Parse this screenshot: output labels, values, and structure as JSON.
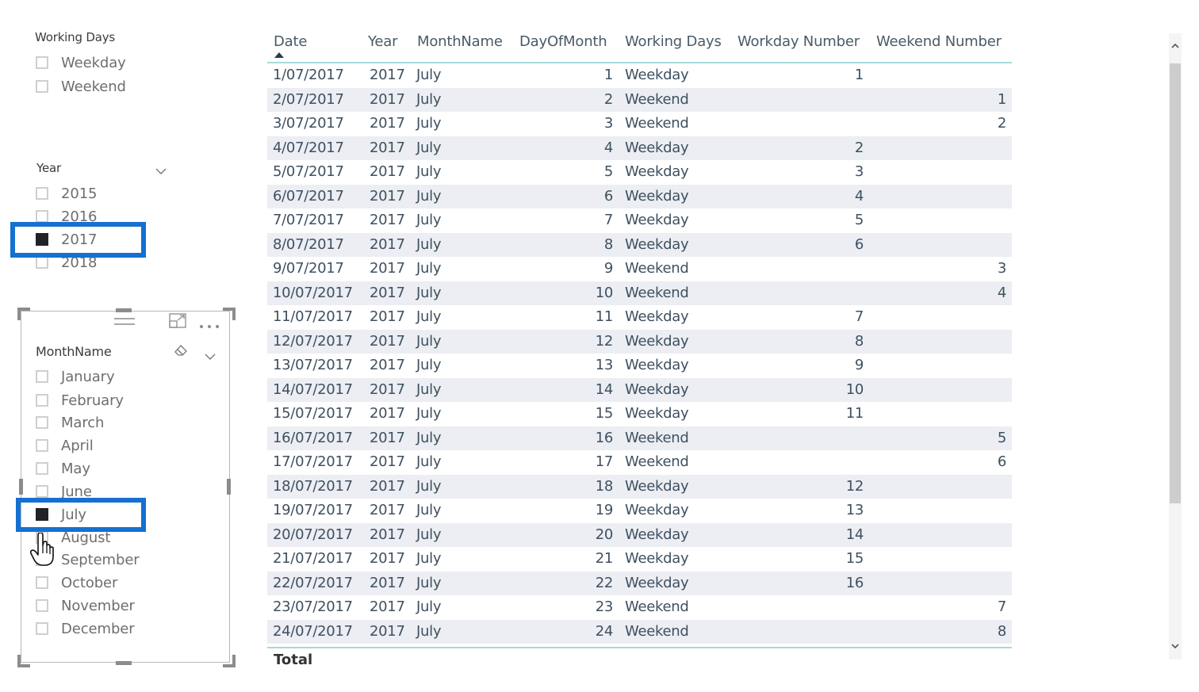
{
  "working_days_slicer": {
    "title": "Working Days",
    "items": [
      {
        "label": "Weekday",
        "checked": false
      },
      {
        "label": "Weekend",
        "checked": false
      }
    ]
  },
  "year_slicer": {
    "title": "Year",
    "dropdown_icon": "chevron-down-icon",
    "items": [
      {
        "label": "2015",
        "checked": false
      },
      {
        "label": "2016",
        "checked": false
      },
      {
        "label": "2017",
        "checked": true
      },
      {
        "label": "2018",
        "checked": false
      }
    ]
  },
  "month_slicer": {
    "title": "MonthName",
    "header_icons": [
      "drag-handle-icon",
      "focus-mode-icon",
      "more-options-icon"
    ],
    "title_icons": [
      "eraser-icon",
      "chevron-down-icon"
    ],
    "items": [
      {
        "label": "January",
        "checked": false
      },
      {
        "label": "February",
        "checked": false
      },
      {
        "label": "March",
        "checked": false
      },
      {
        "label": "April",
        "checked": false
      },
      {
        "label": "May",
        "checked": false
      },
      {
        "label": "June",
        "checked": false
      },
      {
        "label": "July",
        "checked": true
      },
      {
        "label": "August",
        "checked": false
      },
      {
        "label": "September",
        "checked": false
      },
      {
        "label": "October",
        "checked": false
      },
      {
        "label": "November",
        "checked": false
      },
      {
        "label": "December",
        "checked": false
      }
    ]
  },
  "highlight_color": "#1570d1",
  "table": {
    "columns": [
      "Date",
      "Year",
      "MonthName",
      "DayOfMonth",
      "Working Days",
      "Workday Number",
      "Weekend Number"
    ],
    "sorted_column": "Date",
    "sort_direction": "ascending",
    "rows": [
      [
        "1/07/2017",
        "2017",
        "July",
        "1",
        "Weekday",
        "1",
        ""
      ],
      [
        "2/07/2017",
        "2017",
        "July",
        "2",
        "Weekend",
        "",
        "1"
      ],
      [
        "3/07/2017",
        "2017",
        "July",
        "3",
        "Weekend",
        "",
        "2"
      ],
      [
        "4/07/2017",
        "2017",
        "July",
        "4",
        "Weekday",
        "2",
        ""
      ],
      [
        "5/07/2017",
        "2017",
        "July",
        "5",
        "Weekday",
        "3",
        ""
      ],
      [
        "6/07/2017",
        "2017",
        "July",
        "6",
        "Weekday",
        "4",
        ""
      ],
      [
        "7/07/2017",
        "2017",
        "July",
        "7",
        "Weekday",
        "5",
        ""
      ],
      [
        "8/07/2017",
        "2017",
        "July",
        "8",
        "Weekday",
        "6",
        ""
      ],
      [
        "9/07/2017",
        "2017",
        "July",
        "9",
        "Weekend",
        "",
        "3"
      ],
      [
        "10/07/2017",
        "2017",
        "July",
        "10",
        "Weekend",
        "",
        "4"
      ],
      [
        "11/07/2017",
        "2017",
        "July",
        "11",
        "Weekday",
        "7",
        ""
      ],
      [
        "12/07/2017",
        "2017",
        "July",
        "12",
        "Weekday",
        "8",
        ""
      ],
      [
        "13/07/2017",
        "2017",
        "July",
        "13",
        "Weekday",
        "9",
        ""
      ],
      [
        "14/07/2017",
        "2017",
        "July",
        "14",
        "Weekday",
        "10",
        ""
      ],
      [
        "15/07/2017",
        "2017",
        "July",
        "15",
        "Weekday",
        "11",
        ""
      ],
      [
        "16/07/2017",
        "2017",
        "July",
        "16",
        "Weekend",
        "",
        "5"
      ],
      [
        "17/07/2017",
        "2017",
        "July",
        "17",
        "Weekend",
        "",
        "6"
      ],
      [
        "18/07/2017",
        "2017",
        "July",
        "18",
        "Weekday",
        "12",
        ""
      ],
      [
        "19/07/2017",
        "2017",
        "July",
        "19",
        "Weekday",
        "13",
        ""
      ],
      [
        "20/07/2017",
        "2017",
        "July",
        "20",
        "Weekday",
        "14",
        ""
      ],
      [
        "21/07/2017",
        "2017",
        "July",
        "21",
        "Weekday",
        "15",
        ""
      ],
      [
        "22/07/2017",
        "2017",
        "July",
        "22",
        "Weekday",
        "16",
        ""
      ],
      [
        "23/07/2017",
        "2017",
        "July",
        "23",
        "Weekend",
        "",
        "7"
      ],
      [
        "24/07/2017",
        "2017",
        "July",
        "24",
        "Weekend",
        "",
        "8"
      ]
    ],
    "total_label": "Total"
  },
  "scrollbar": {
    "up_icon": "^",
    "down_icon": "v"
  }
}
